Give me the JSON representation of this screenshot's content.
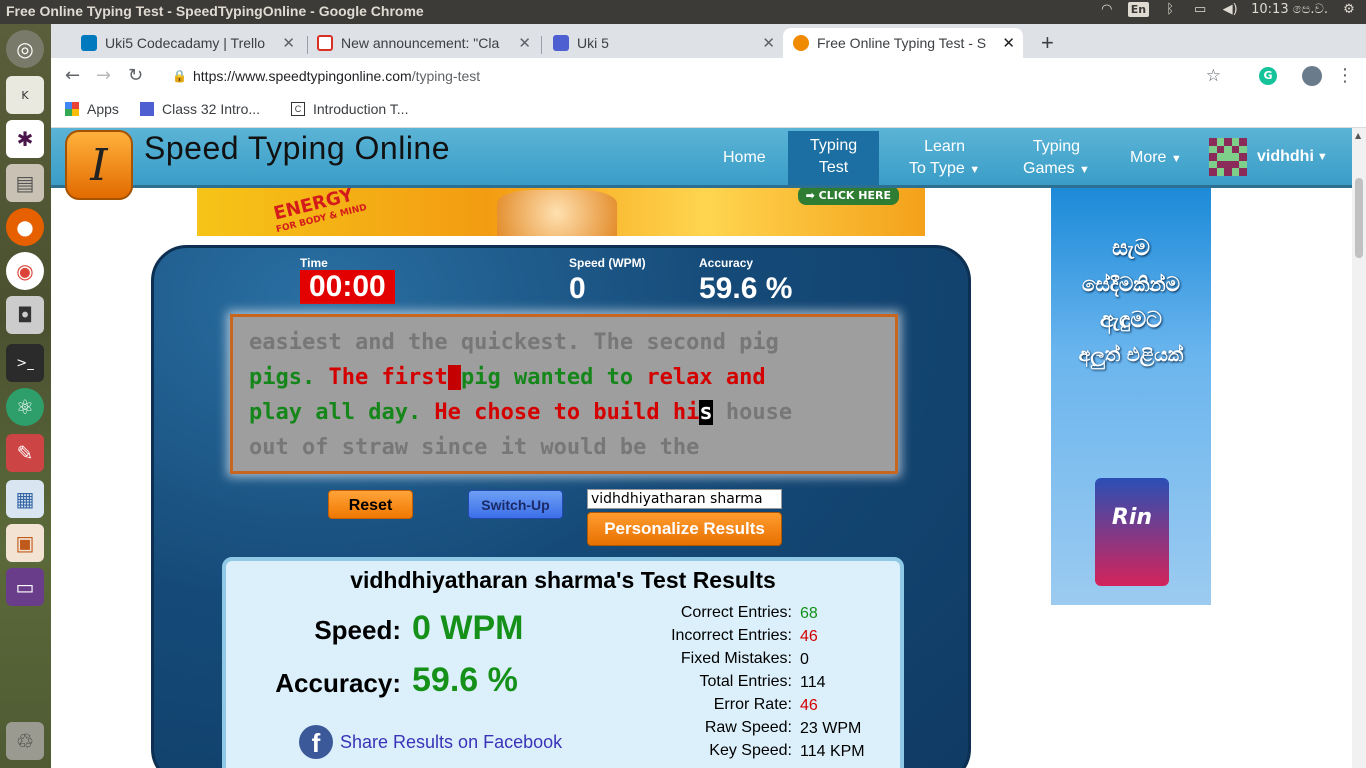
{
  "os": {
    "window_title": "Free Online Typing Test - SpeedTypingOnline - Google Chrome",
    "keyboard": "En",
    "clock": "10:13 පෙ.ව."
  },
  "tabs": [
    {
      "label": "Uki5 Codecadamy | Trello",
      "icon": "trello-icon"
    },
    {
      "label": "New announcement: \"Cla",
      "icon": "gmail-icon"
    },
    {
      "label": "Uki 5",
      "icon": "classroom-icon"
    },
    {
      "label": "Free Online Typing Test - S",
      "icon": "speedtyping-icon"
    }
  ],
  "url": {
    "host": "https://www.speedtypingonline.com",
    "path": "/typing-test"
  },
  "bookmarks": [
    {
      "label": "Apps"
    },
    {
      "label": "Class 32 Intro..."
    },
    {
      "label": "Introduction T..."
    }
  ],
  "site": {
    "name": "Speed Typing Online",
    "logo_letter": "I",
    "nav": {
      "home": "Home",
      "typing_test_1": "Typing",
      "typing_test_2": "Test",
      "learn_1": "Learn",
      "learn_2": "To Type",
      "games_1": "Typing",
      "games_2": "Games",
      "more": "More",
      "dropdown": "▼"
    },
    "user": "vidhdhi"
  },
  "ads": {
    "banner_energy": "ENERGY",
    "banner_sub": "FOR BODY & MIND",
    "banner_click": "➡ CLICK HERE",
    "side_lines": [
      "සැම",
      "සේදීමකින්ම",
      "ඇඳුමට",
      "අලුත් එළියක්"
    ],
    "side_brand": "Rin"
  },
  "test": {
    "time_label": "Time",
    "time_value": "00:00",
    "speed_label": "Speed (WPM)",
    "speed_value": "0",
    "accuracy_label": "Accuracy",
    "accuracy_value": "59.6 %",
    "line1": "easiest and the quickest. The second pig",
    "line2_a": "pigs. ",
    "line2_b": "The",
    "line2_c": " first",
    "line2_d": " ",
    "line2_e": "pig wanted to",
    "line2_f": " relax and",
    "line3_a": "play all day.",
    "line3_b": " He chose to build hi",
    "line3_cur": "s",
    "line3_rest": " house",
    "line4": "out of straw since it would be the",
    "reset": "Reset",
    "switch_up": "Switch-Up",
    "name_value": "vidhdhiyatharan sharma",
    "personalize": "Personalize Results"
  },
  "results": {
    "title": "vidhdhiyatharan sharma's Test Results",
    "speed_label": "Speed:",
    "speed_value": "0 WPM",
    "accuracy_label": "Accuracy:",
    "accuracy_value": "59.6 %",
    "rows": [
      {
        "label": "Correct Entries:",
        "value": "68"
      },
      {
        "label": "Incorrect Entries:",
        "value": "46"
      },
      {
        "label": "Fixed Mistakes:",
        "value": "0"
      },
      {
        "label": "Total Entries:",
        "value": "114"
      },
      {
        "label": "Error Rate:",
        "value": "46"
      },
      {
        "label": "Raw Speed:",
        "value": "23 WPM"
      },
      {
        "label": "Key Speed:",
        "value": "114 KPM"
      }
    ],
    "share": "Share Results on Facebook",
    "fb_letter": "f"
  },
  "colors": {
    "correct": "#15871a",
    "incorrect": "#d40000",
    "nav": "#3a9dc7",
    "panel": "#154a78"
  }
}
